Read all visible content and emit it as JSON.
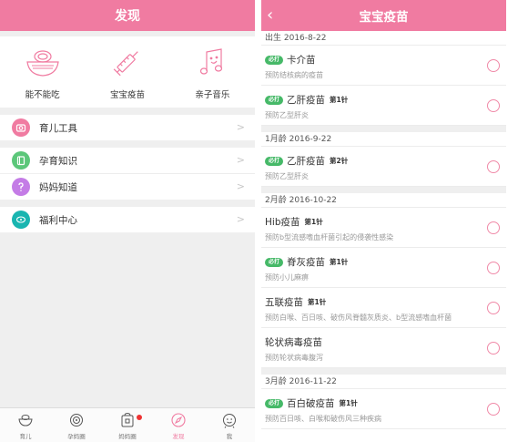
{
  "left": {
    "title": "发现",
    "quick": [
      {
        "label": "能不能吃",
        "icon": "bowl-icon"
      },
      {
        "label": "宝宝疫苗",
        "icon": "syringe-icon"
      },
      {
        "label": "亲子音乐",
        "icon": "music-note-icon"
      }
    ],
    "rows": [
      {
        "label": "育儿工具",
        "icon": "camera-icon",
        "color": "#f07ba1"
      },
      {
        "label": "孕育知识",
        "icon": "book-icon",
        "color": "#5cc77a"
      },
      {
        "label": "妈妈知道",
        "icon": "question-icon",
        "color": "#c47ce6"
      },
      {
        "label": "福利中心",
        "icon": "welfare-icon",
        "color": "#19b5b0"
      }
    ],
    "tabs": [
      {
        "label": "育儿",
        "icon": "bowl-tab-icon",
        "active": false
      },
      {
        "label": "孕妈圈",
        "icon": "circle-tab-icon",
        "active": false
      },
      {
        "label": "妈妈圈",
        "icon": "bag-tab-icon",
        "active": false,
        "dot": true
      },
      {
        "label": "发现",
        "icon": "compass-tab-icon",
        "active": true
      },
      {
        "label": "我",
        "icon": "face-tab-icon",
        "active": false
      }
    ]
  },
  "right": {
    "title": "宝宝疫苗",
    "back_icon": "chevron-left-icon",
    "badge": "必打",
    "groups": [
      {
        "header": "出生  2016-8-22",
        "items": [
          {
            "name": "卡介苗",
            "dose": "",
            "desc": "预防结核病的疫苗",
            "required": true
          },
          {
            "name": "乙肝疫苗",
            "dose": "第1针",
            "desc": "预防乙型肝炎",
            "required": true
          }
        ]
      },
      {
        "header": "1月龄  2016-9-22",
        "items": [
          {
            "name": "乙肝疫苗",
            "dose": "第2针",
            "desc": "预防乙型肝炎",
            "required": true
          }
        ]
      },
      {
        "header": "2月龄  2016-10-22",
        "items": [
          {
            "name": "Hib疫苗",
            "dose": "第1针",
            "desc": "预防b型流感嗜血杆菌引起的侵袭性感染",
            "required": false
          },
          {
            "name": "脊灰疫苗",
            "dose": "第1针",
            "desc": "预防小儿麻痹",
            "required": true
          },
          {
            "name": "五联疫苗",
            "dose": "第1针",
            "desc": "预防白喉、百日咳、破伤风脊髓灰质炎、b型流感嗜血杆菌",
            "required": false
          },
          {
            "name": "轮状病毒疫苗",
            "dose": "",
            "desc": "预防轮状病毒腹泻",
            "required": false
          }
        ]
      },
      {
        "header": "3月龄  2016-11-22",
        "items": [
          {
            "name": "百白破疫苗",
            "dose": "第1针",
            "desc": "预防百日咳、白喉和破伤风三种疾病",
            "required": true
          }
        ]
      }
    ]
  },
  "colors": {
    "brand": "#f07ba1",
    "badge": "#46b968",
    "radio": "#f08aa8"
  }
}
